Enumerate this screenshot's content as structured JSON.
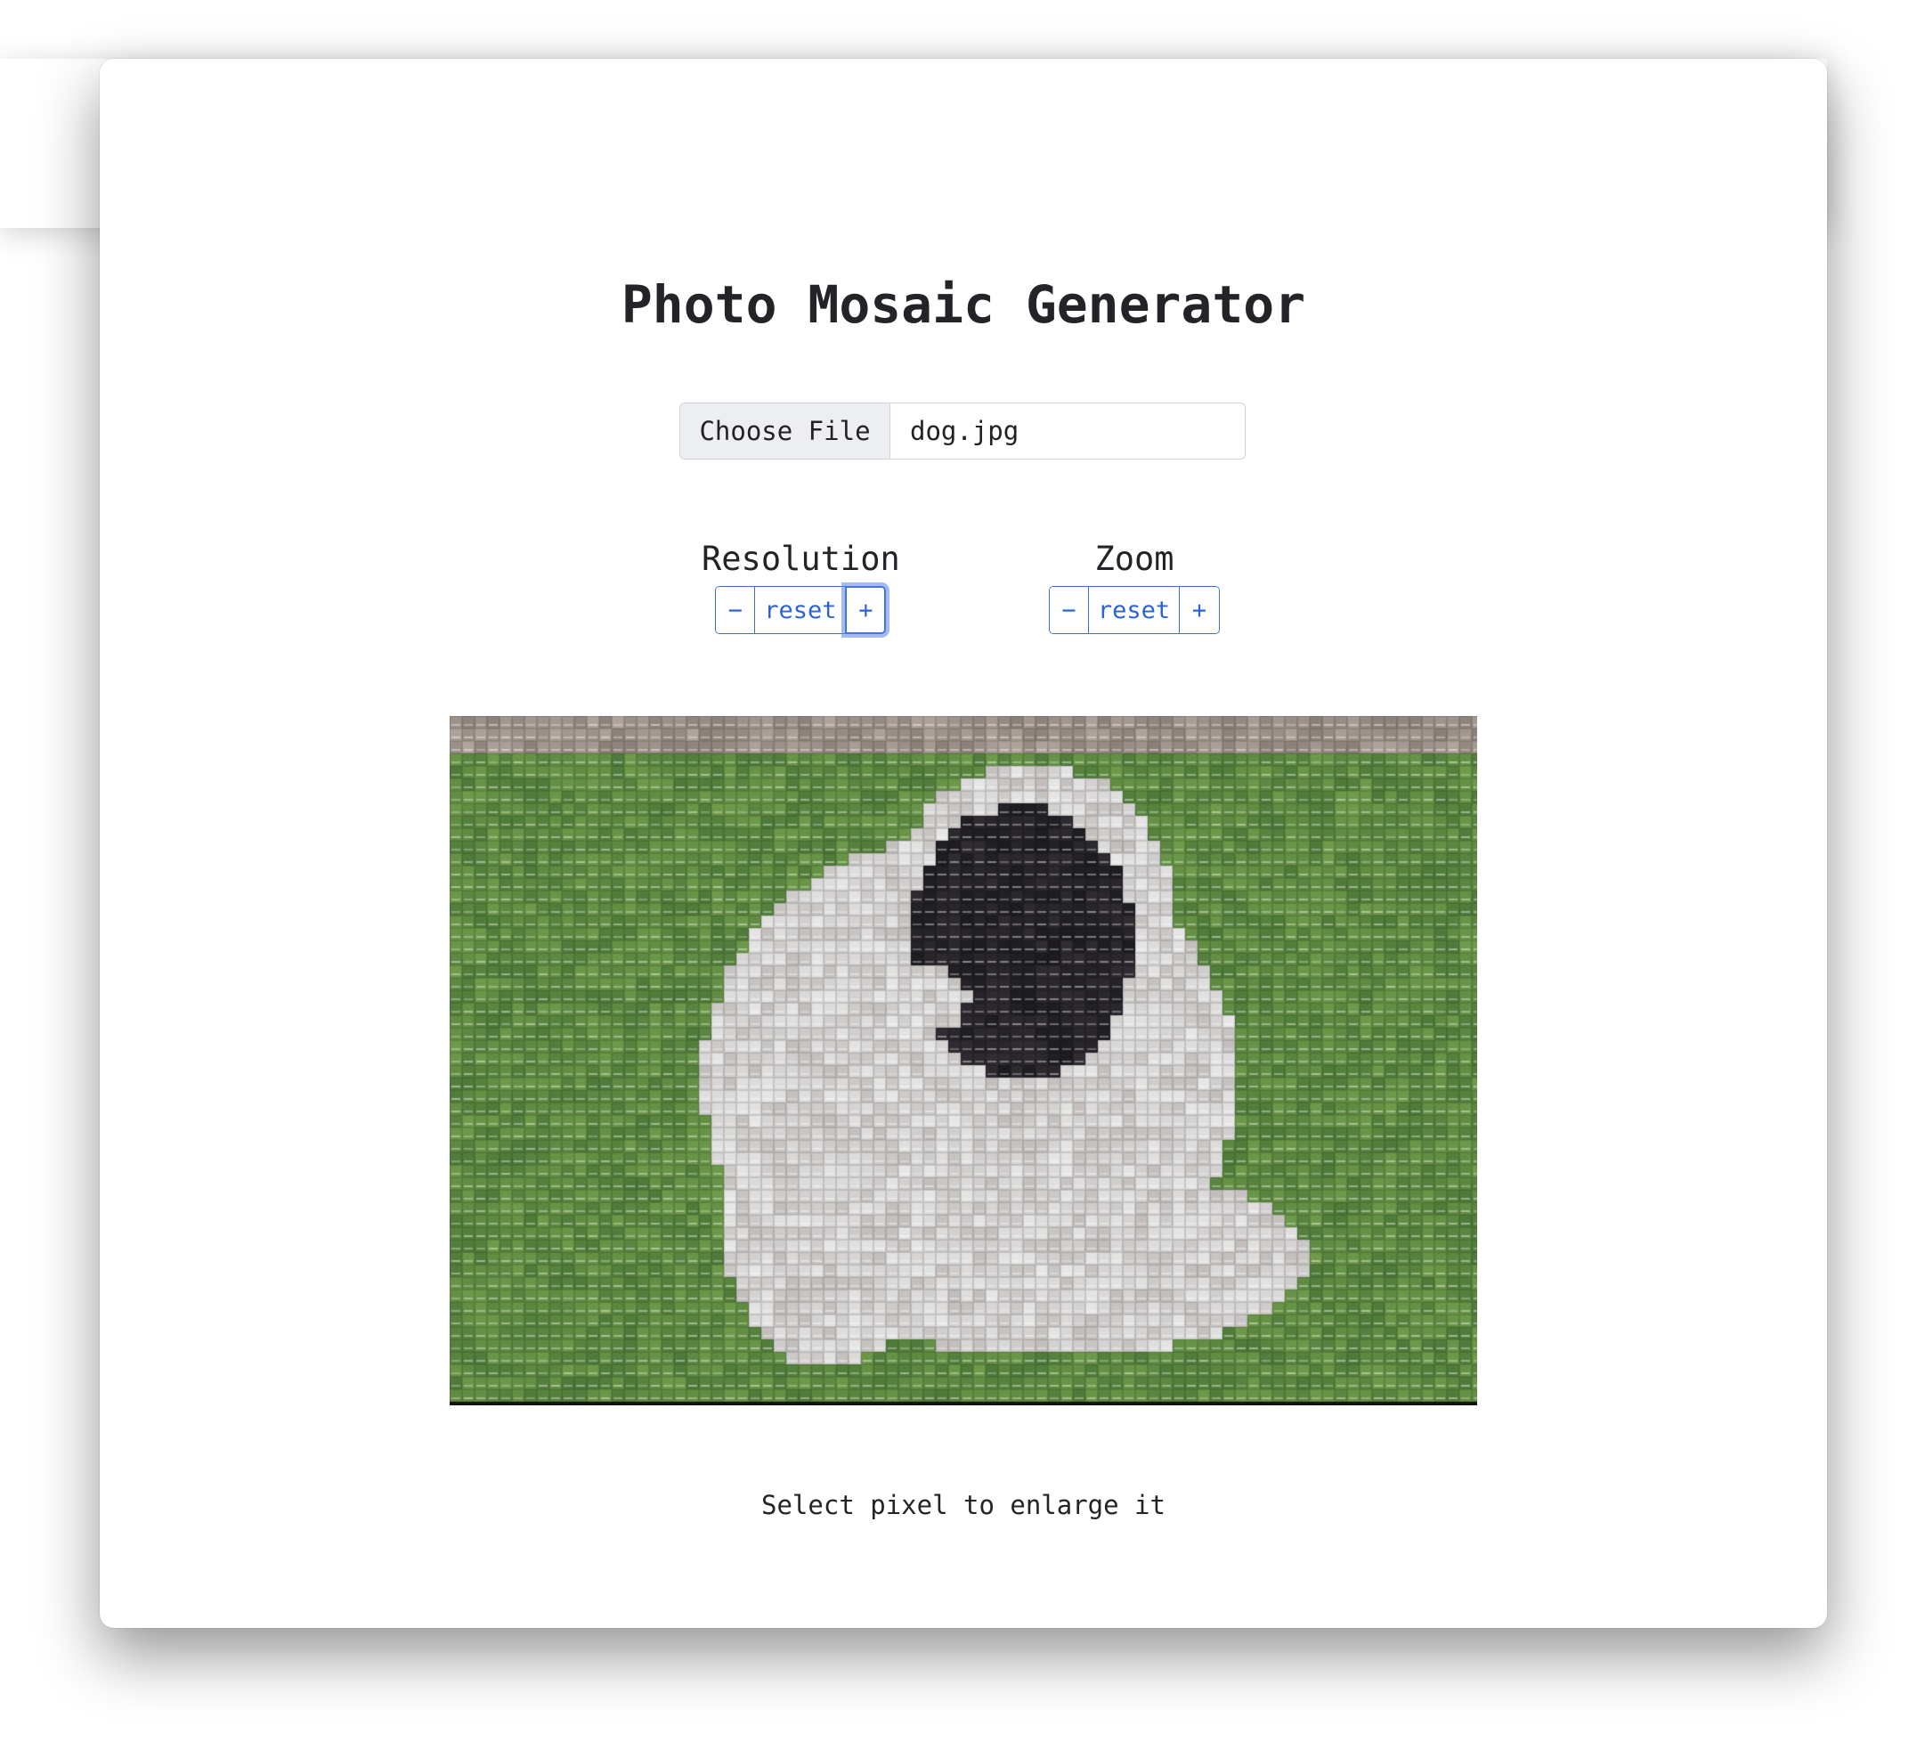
{
  "app": {
    "title": "Photo Mosaic Generator"
  },
  "file_input": {
    "button_label": "Choose File",
    "file_name": "dog.jpg"
  },
  "controls": {
    "resolution": {
      "label": "Resolution",
      "minus": "−",
      "reset": "reset",
      "plus": "+"
    },
    "zoom": {
      "label": "Zoom",
      "minus": "−",
      "reset": "reset",
      "plus": "+"
    }
  },
  "mosaic": {
    "subject": "dog",
    "colors": {
      "grass": "#4e7a3a",
      "grass_light": "#6e9a4a",
      "fur_white": "#e6e6e6",
      "face_dark": "#1c1c20",
      "top_strip": "#8a8078",
      "bottom_strip": "#141414"
    }
  },
  "hint": "Select pixel to enlarge it",
  "colors": {
    "accent": "#2b63d6",
    "text": "#222428"
  }
}
